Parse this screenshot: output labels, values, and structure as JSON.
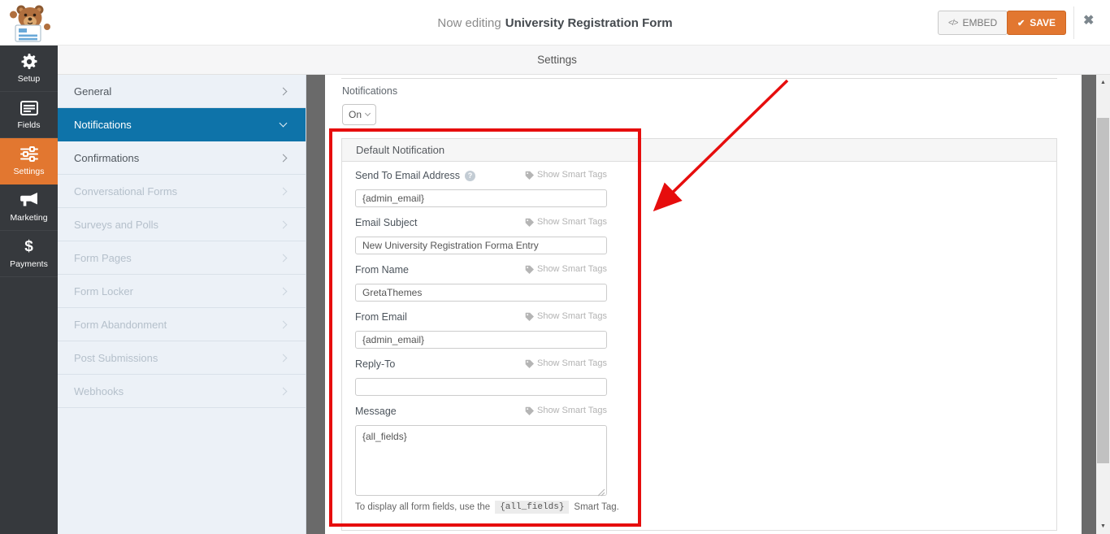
{
  "topbar": {
    "now_editing_prefix": "Now editing",
    "form_title": "University Registration Form",
    "embed_label": "EMBED",
    "save_label": "SAVE"
  },
  "icons": {
    "embed_code": "</>",
    "save_check": "✔",
    "close": "✖",
    "help": "?",
    "payments_dollar": "$",
    "scroll_up": "▲",
    "scroll_down": "▼"
  },
  "nav": {
    "items": [
      {
        "label": "Setup"
      },
      {
        "label": "Fields"
      },
      {
        "label": "Settings",
        "active": true
      },
      {
        "label": "Marketing"
      },
      {
        "label": "Payments"
      }
    ]
  },
  "settings_bar": {
    "title": "Settings"
  },
  "settings_menu": {
    "items": [
      {
        "label": "General",
        "state": "enabled"
      },
      {
        "label": "Notifications",
        "state": "active"
      },
      {
        "label": "Confirmations",
        "state": "enabled"
      },
      {
        "label": "Conversational Forms",
        "state": "disabled"
      },
      {
        "label": "Surveys and Polls",
        "state": "disabled"
      },
      {
        "label": "Form Pages",
        "state": "disabled"
      },
      {
        "label": "Form Locker",
        "state": "disabled"
      },
      {
        "label": "Form Abandonment",
        "state": "disabled"
      },
      {
        "label": "Post Submissions",
        "state": "disabled"
      },
      {
        "label": "Webhooks",
        "state": "disabled"
      }
    ]
  },
  "content": {
    "section_label": "Notifications",
    "toggle_value": "On",
    "smart_tags_label": "Show Smart Tags",
    "panel": {
      "title": "Default Notification",
      "fields": [
        {
          "label": "Send To Email Address",
          "value": "{admin_email}"
        },
        {
          "label": "Email Subject",
          "value": "New University Registration Forma Entry"
        },
        {
          "label": "From Name",
          "value": "GretaThemes"
        },
        {
          "label": "From Email",
          "value": "{admin_email}"
        },
        {
          "label": "Reply-To",
          "value": ""
        },
        {
          "label": "Message",
          "value": "{all_fields}"
        }
      ],
      "note": {
        "prefix": "To display all form fields, use the",
        "code": "{all_fields}",
        "suffix": "Smart Tag."
      }
    }
  },
  "colors": {
    "accent_orange": "#e27730",
    "active_blue": "#0e73a9",
    "annotation_red": "#e60d0d",
    "sidebar_dark": "#36393d"
  }
}
